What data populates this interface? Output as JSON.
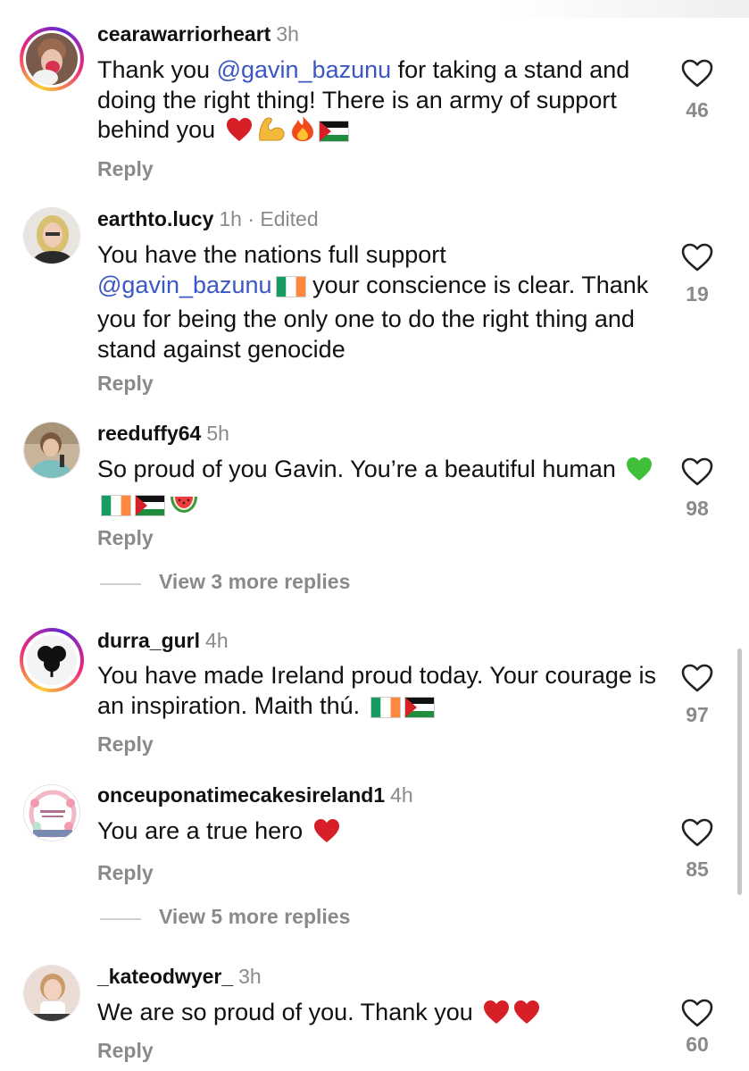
{
  "comments": [
    {
      "username": "cearawarriorheart",
      "time": "3h",
      "edited": "",
      "text_before": "Thank you ",
      "mention": "@gavin_bazunu",
      "text_after": " for taking a stand and doing the right thing! There is an army of support behind you",
      "emojis": [
        "red-heart",
        "flexed-biceps",
        "fire",
        "palestine-flag"
      ],
      "reply": "Reply",
      "likes": "46",
      "avatar_ring": true
    },
    {
      "username": "earthto.lucy",
      "time": "1h",
      "edited": "· Edited",
      "line1": "You have the nations full support",
      "mention": "@gavin_bazunu",
      "text_after": " your conscience is clear. Thank you for being the only one to do the right thing and stand against genocide",
      "emojis": [
        "ireland-flag"
      ],
      "reply": "Reply",
      "likes": "19",
      "avatar_ring": false
    },
    {
      "username": "reeduffy64",
      "time": "5h",
      "edited": "",
      "text": "So proud of you Gavin.  You’re a beautiful human",
      "emojis": [
        "green-heart",
        "ireland-flag",
        "palestine-flag",
        "watermelon"
      ],
      "reply": "Reply",
      "likes": "98",
      "avatar_ring": false,
      "view_more": "View 3 more replies"
    },
    {
      "username": "durra_gurl",
      "time": "4h",
      "edited": "",
      "text": "You have made Ireland proud today. Your courage is an inspiration. Maith thú.",
      "emojis": [
        "ireland-flag",
        "palestine-flag"
      ],
      "reply": "Reply",
      "likes": "97",
      "avatar_ring": true
    },
    {
      "username": "onceuponatimecakesireland1",
      "time": "4h",
      "edited": "",
      "text": "You are a true hero",
      "emojis": [
        "red-heart"
      ],
      "reply": "Reply",
      "likes": "85",
      "avatar_ring": false,
      "view_more": "View 5 more replies"
    },
    {
      "username": "_kateodwyer_",
      "time": "3h",
      "edited": "",
      "text": "We are so proud of you. Thank you",
      "emojis": [
        "red-heart",
        "red-heart"
      ],
      "reply": "Reply",
      "likes": "60",
      "avatar_ring": false
    }
  ],
  "icons": {
    "like": "heart-outline-icon"
  },
  "colors": {
    "mention": "#3b57c4",
    "muted": "#8a8a8a",
    "text": "#111111"
  }
}
